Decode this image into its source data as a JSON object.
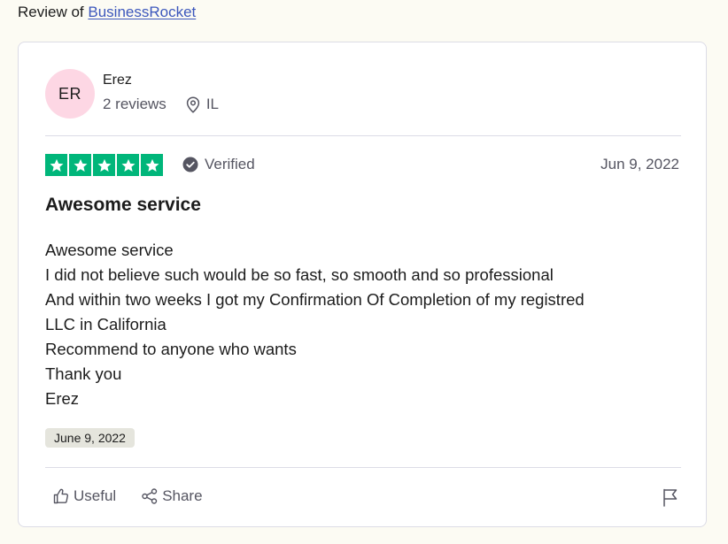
{
  "header": {
    "prefix": "Review of",
    "company_link": "BusinessRocket"
  },
  "reviewer": {
    "initials": "ER",
    "name": "Erez",
    "reviews_count": "2 reviews",
    "location": "IL",
    "avatar_color": "#fdd7e4"
  },
  "rating": {
    "stars": 5,
    "max_stars": 5,
    "star_color": "#00b67a"
  },
  "verified_label": "Verified",
  "review_date": "Jun 9, 2022",
  "review": {
    "title": "Awesome service",
    "lines": [
      "Awesome service",
      "I did not believe such would be so fast, so smooth and so professional",
      "And within two weeks I got my Confirmation Of Completion of my registred",
      "LLC in California",
      "Recommend to anyone who wants",
      "Thank you",
      "Erez"
    ],
    "experience_date": "June 9, 2022"
  },
  "actions": {
    "useful_label": "Useful",
    "share_label": "Share"
  },
  "icons": {
    "location": "location-pin-icon",
    "verified": "check-circle-icon",
    "useful": "thumbs-up-icon",
    "share": "share-icon",
    "report": "flag-icon"
  }
}
